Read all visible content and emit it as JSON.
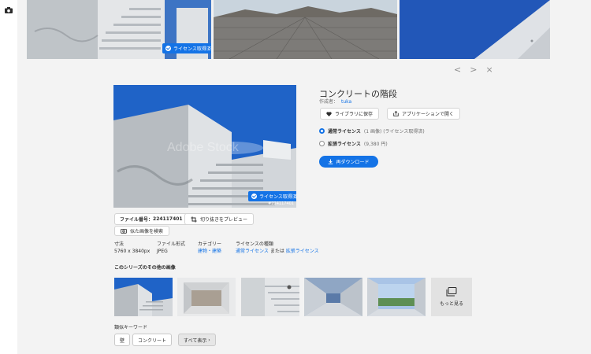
{
  "top_strip": {
    "badge_label": "ライセンス取得済"
  },
  "nav": {
    "prev": "<",
    "next": ">",
    "close": "×"
  },
  "detail": {
    "title": "コンクリートの階段",
    "author_label": "作成者：",
    "author_name": "tuka",
    "save_button": "ライブラリに保存",
    "open_button": "アプリケーションで開く",
    "license_standard": "通常ライセンス",
    "license_standard_sub": "(1 画像) (ライセンス取得済)",
    "license_extended": "拡張ライセンス",
    "license_extended_sub": "(9,380 円)",
    "download_button": "再ダウンロード",
    "image_badge": "ライセンス取得済",
    "image_id": "#224117401",
    "file_number_label": "ファイル番号：",
    "file_number": "224117401",
    "crop_button": "切り抜きをプレビュー",
    "similar_button": "似た画像を検索"
  },
  "meta": {
    "size_label": "寸法",
    "size_value": "5760 x 3840px",
    "format_label": "ファイル形式",
    "format_value": "JPEG",
    "category_label": "カテゴリー",
    "category_value": "建物・建築",
    "license_label": "ライセンスの種類",
    "license_value_a": "通常ライセンス",
    "license_or": "または",
    "license_value_b": "拡張ライセンス"
  },
  "series": {
    "heading": "このシリーズのその他の画像",
    "more_label": "もっと見る"
  },
  "keywords": {
    "heading": "類似キーワード",
    "chips": [
      "壁",
      "コンクリート"
    ],
    "show_all": "すべて表示"
  },
  "colors": {
    "accent": "#1473e6",
    "panel_bg": "#f3f3f3"
  },
  "icons": [
    "camera-icon",
    "heart-icon",
    "share-icon",
    "download-icon",
    "crop-icon",
    "camera-search-icon",
    "stack-icon",
    "check-icon"
  ]
}
